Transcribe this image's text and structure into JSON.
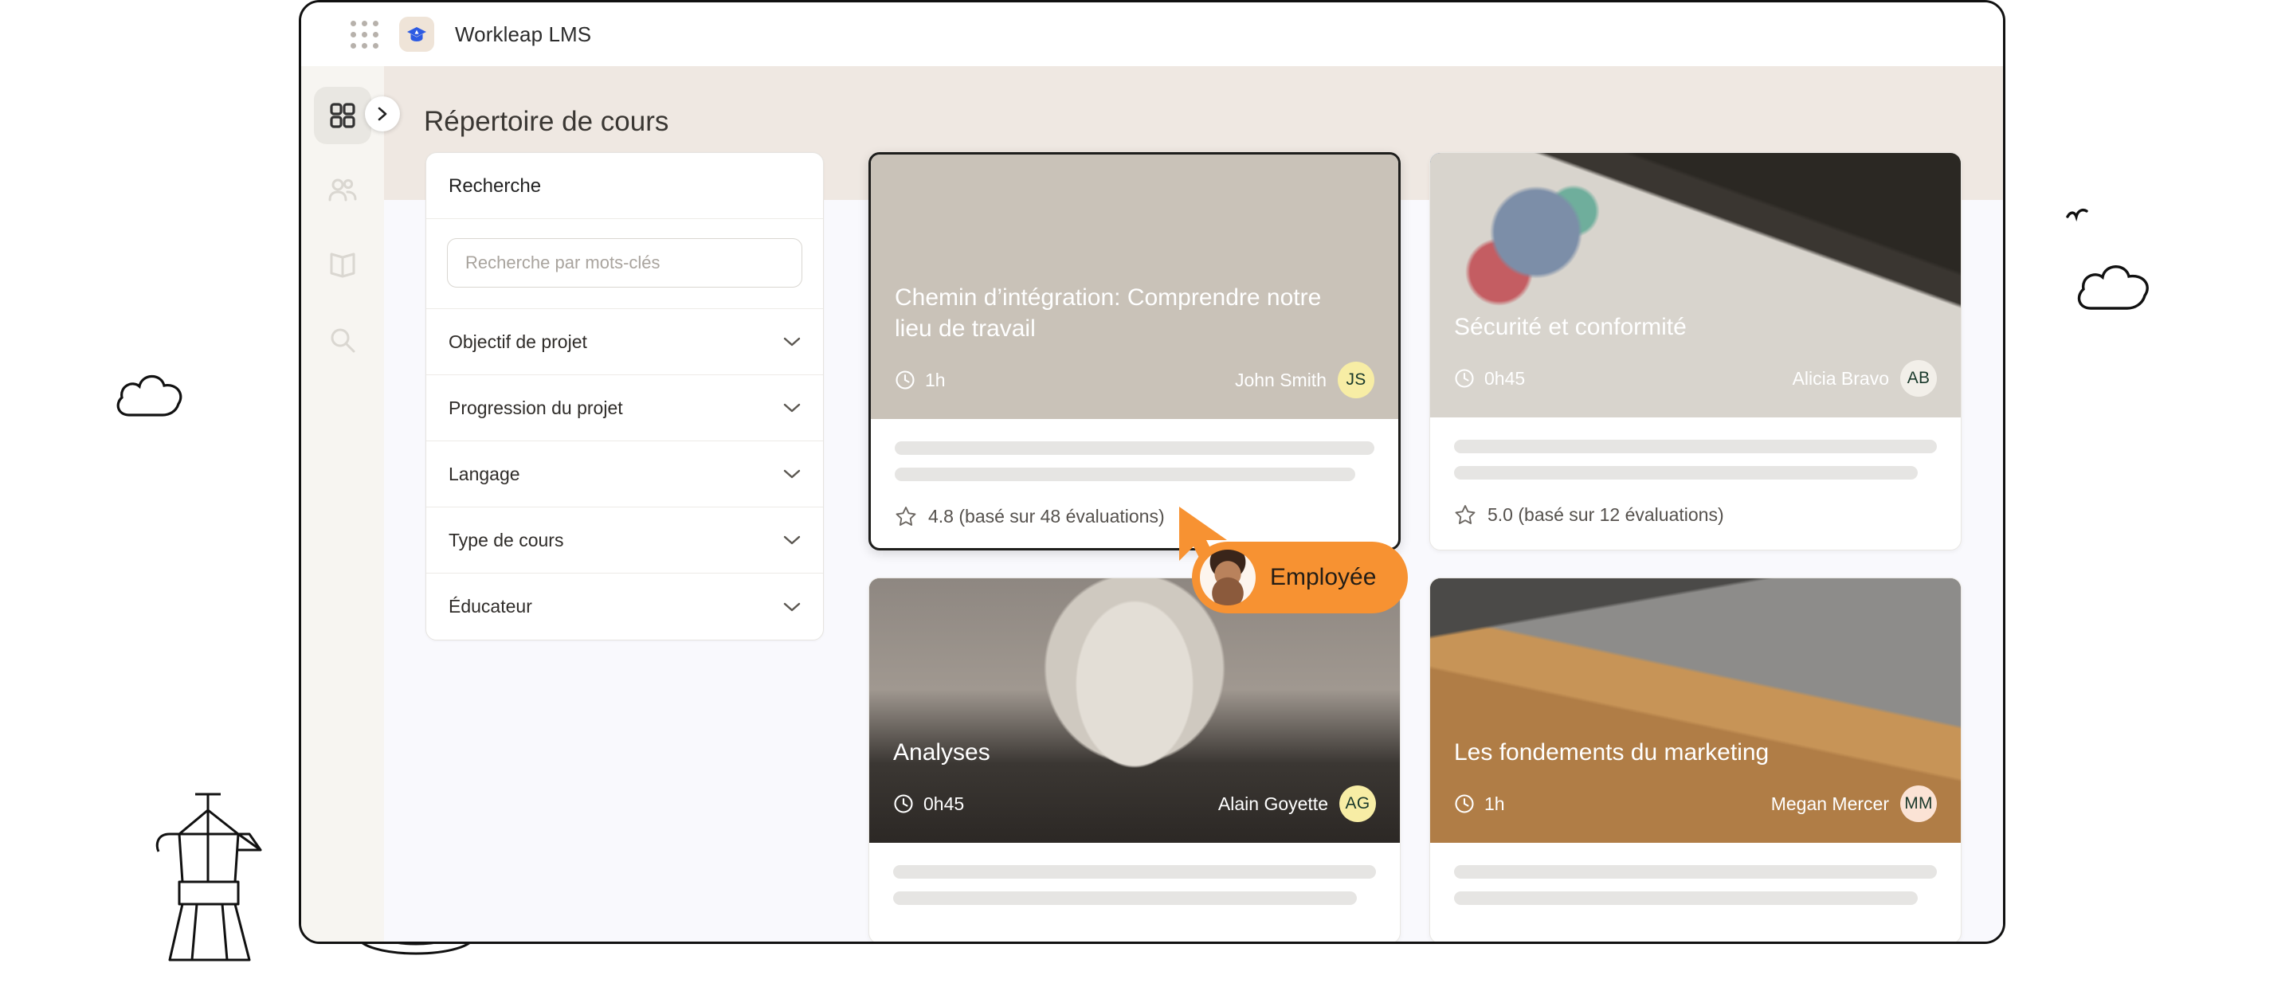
{
  "browser": {
    "topbar": {
      "apps_grid_icon": "apps-grid-icon",
      "brand_logo_icon": "graduation-cap-icon",
      "brand_title": "Workleap LMS"
    }
  },
  "sidebar": {
    "collapse_icon": "chevron-right-icon",
    "items": [
      {
        "name": "dashboard",
        "icon": "grid-icon",
        "active": true
      },
      {
        "name": "people",
        "icon": "people-icon",
        "active": false
      },
      {
        "name": "library",
        "icon": "book-icon",
        "active": false
      },
      {
        "name": "search",
        "icon": "search-icon",
        "active": false
      }
    ]
  },
  "page": {
    "title": "Répertoire de cours",
    "header_bg": "#EFE8E2",
    "body_bg": "#F9F9FD"
  },
  "filters": {
    "panel_title": "Recherche",
    "search_placeholder": "Recherche par mots-clés",
    "search_value": "",
    "rows": [
      {
        "label": "Objectif de projet",
        "icon": "chevron-down-icon"
      },
      {
        "label": "Progression du projet",
        "icon": "chevron-down-icon"
      },
      {
        "label": "Langage",
        "icon": "chevron-down-icon"
      },
      {
        "label": "Type de cours",
        "icon": "chevron-down-icon"
      },
      {
        "label": "Éducateur",
        "icon": "chevron-down-icon"
      }
    ]
  },
  "courses": [
    {
      "title": "Chemin d’intégration: Comprendre notre lieu de travail",
      "duration": "1h",
      "duration_icon": "clock-icon",
      "author": "John Smith",
      "initials": "JS",
      "avatar_color": "#F7EDA5",
      "rating_icon": "star-icon",
      "rating": "4.8 (basé sur 48 évaluations)",
      "selected": true,
      "photo": "photo-desk"
    },
    {
      "title": "Sécurité et conformité",
      "duration": "0h45",
      "duration_icon": "clock-icon",
      "author": "Alicia Bravo",
      "initials": "AB",
      "avatar_color": "#F2EFE9",
      "rating_icon": "star-icon",
      "rating": "5.0 (basé sur 12 évaluations)",
      "selected": false,
      "photo": "photo-desk2"
    },
    {
      "title": "Analyses",
      "duration": "0h45",
      "duration_icon": "clock-icon",
      "author": "Alain Goyette",
      "initials": "AG",
      "avatar_color": "#F7EDA5",
      "rating_icon": "star-icon",
      "rating": "",
      "selected": false,
      "photo": "photo-person"
    },
    {
      "title": "Les fondements du marketing",
      "duration": "1h",
      "duration_icon": "clock-icon",
      "author": "Megan Mercer",
      "initials": "MM",
      "avatar_color": "#FBE3D5",
      "rating_icon": "star-icon",
      "rating": "",
      "selected": false,
      "photo": "photo-room"
    }
  ],
  "employee_badge": {
    "label": "Employée",
    "color": "#F79232",
    "cursor_icon": "cursor-arrow-icon",
    "avatar_icon": "person-photo-avatar"
  },
  "decorations": [
    {
      "name": "cloud-doodle-left",
      "icon": "cloud-icon"
    },
    {
      "name": "cloud-doodle-right",
      "icon": "cloud-icon"
    },
    {
      "name": "bird-doodle",
      "icon": "bird-icon"
    },
    {
      "name": "moka-pot-doodle",
      "icon": "moka-pot-icon"
    },
    {
      "name": "coffee-cup-doodle",
      "icon": "coffee-cup-icon"
    }
  ]
}
